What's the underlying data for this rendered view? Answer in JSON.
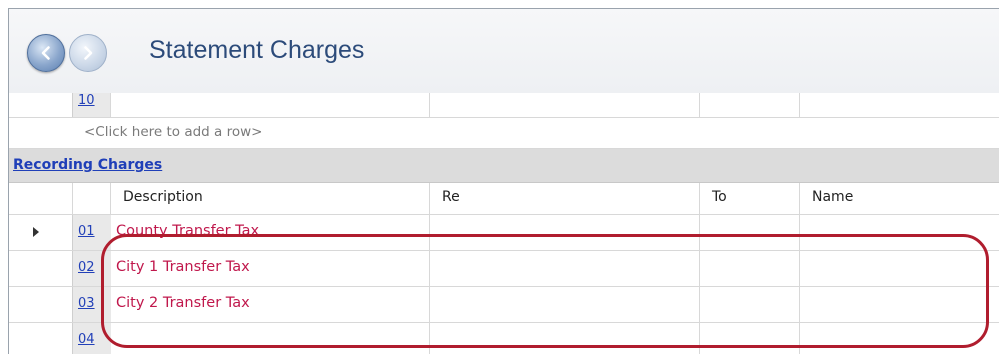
{
  "header": {
    "title": "Statement Charges",
    "back_icon": "back-arrow-icon",
    "forward_icon": "forward-arrow-icon"
  },
  "top_grid": {
    "last_row_number": "10",
    "add_row_text": "<Click here to add a row>"
  },
  "section": {
    "title": "Recording Charges"
  },
  "columns": {
    "description": "Description",
    "re": "Re",
    "to": "To",
    "name": "Name"
  },
  "rows": [
    {
      "number": "01",
      "description": "County Transfer Tax"
    },
    {
      "number": "02",
      "description": "City 1 Transfer Tax"
    },
    {
      "number": "03",
      "description": "City 2 Transfer Tax"
    },
    {
      "number": "04",
      "description": ""
    }
  ],
  "colors": {
    "description_text": "#c0184c",
    "link": "#2240b8",
    "highlight_outline": "#b01d2e",
    "title": "#2c4b7a"
  }
}
